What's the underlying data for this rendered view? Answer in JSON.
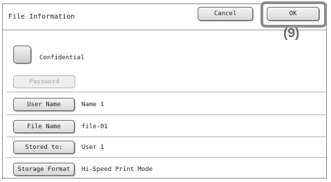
{
  "dialog": {
    "title": "File Information",
    "cancel_label": "Cancel",
    "ok_label": "OK",
    "step_marker": "(9)"
  },
  "confidential": {
    "label": "Confidential",
    "checked": false
  },
  "password": {
    "label": "Password",
    "enabled": false
  },
  "rows": [
    {
      "label": "User Name",
      "value": "Name 1"
    },
    {
      "label": "File Name",
      "value": "file-01"
    },
    {
      "label": "Stored to:",
      "value": "User 1"
    },
    {
      "label": "Storage Format",
      "value": "Hi-Speed Print Mode"
    }
  ]
}
